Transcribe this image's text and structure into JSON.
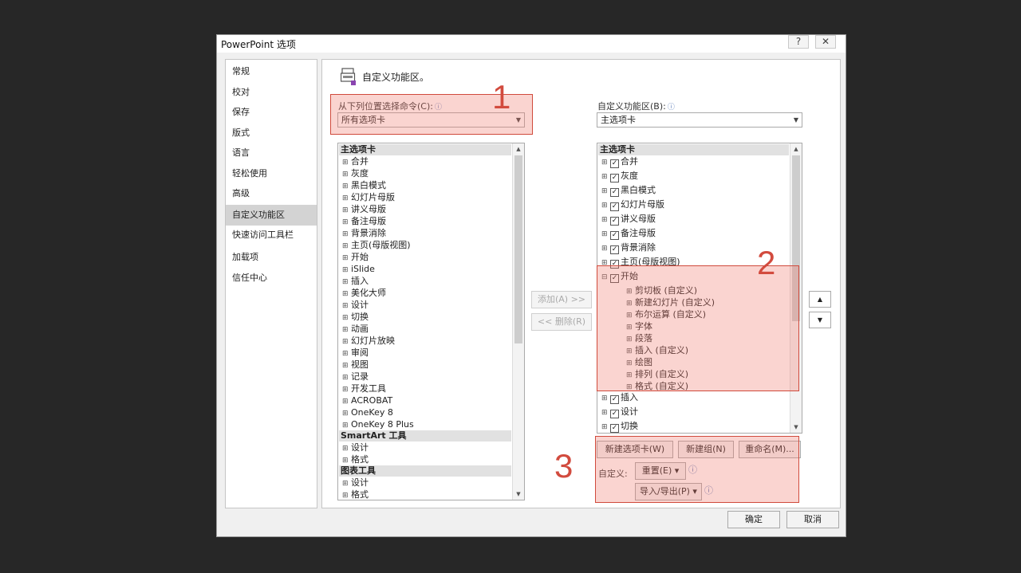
{
  "window": {
    "title": "PowerPoint 选项",
    "help": "?",
    "close": "✕"
  },
  "nav": [
    "常规",
    "校对",
    "保存",
    "版式",
    "语言",
    "轻松使用",
    "高级",
    "自定义功能区",
    "快速访问工具栏",
    "加载项",
    "信任中心"
  ],
  "header": {
    "title": "自定义功能区。"
  },
  "left": {
    "label": "从下列位置选择命令(C):",
    "select_value": "所有选项卡",
    "groups": [
      {
        "title": "主选项卡",
        "items": [
          "合并",
          "灰度",
          "黑白模式",
          "幻灯片母版",
          "讲义母版",
          "备注母版",
          "背景消除",
          "主页(母版视图)",
          "开始",
          "iSlide",
          "插入",
          "美化大师",
          "设计",
          "切换",
          "动画",
          "幻灯片放映",
          "审阅",
          "视图",
          "记录",
          "开发工具",
          "ACROBAT",
          "OneKey 8",
          "OneKey 8 Plus"
        ]
      },
      {
        "title": "SmartArt 工具",
        "items": [
          "设计",
          "格式"
        ]
      },
      {
        "title": "图表工具",
        "items": [
          "设计",
          "格式"
        ]
      }
    ]
  },
  "middle": {
    "add": "添加(A) >>",
    "remove": "<< 删除(R)"
  },
  "right": {
    "label": "自定义功能区(B):",
    "select_value": "主选项卡",
    "group_title": "主选项卡",
    "tabs_before": [
      "合并",
      "灰度",
      "黑白模式",
      "幻灯片母版",
      "讲义母版",
      "备注母版",
      "背景消除",
      "主页(母版视图)"
    ],
    "expanded_tab": "开始",
    "sub_items": [
      "剪切板 (自定义)",
      "新建幻灯片 (自定义)",
      "布尔运算 (自定义)",
      "字体",
      "段落",
      "插入 (自定义)",
      "绘图",
      "排列 (自定义)",
      "格式 (自定义)"
    ],
    "tabs_after": [
      "插入",
      "设计",
      "切换"
    ]
  },
  "bottom": {
    "new_tab": "新建选项卡(W)",
    "new_group": "新建组(N)",
    "rename": "重命名(M)...",
    "custom_label": "自定义:",
    "reset": "重置(E) ▾",
    "import_export": "导入/导出(P) ▾"
  },
  "footer": {
    "ok": "确定",
    "cancel": "取消"
  },
  "annotations": [
    "1",
    "2",
    "3"
  ],
  "colors": {
    "highlight": "#d04a3c",
    "selected_nav": "#d3d3d3"
  }
}
